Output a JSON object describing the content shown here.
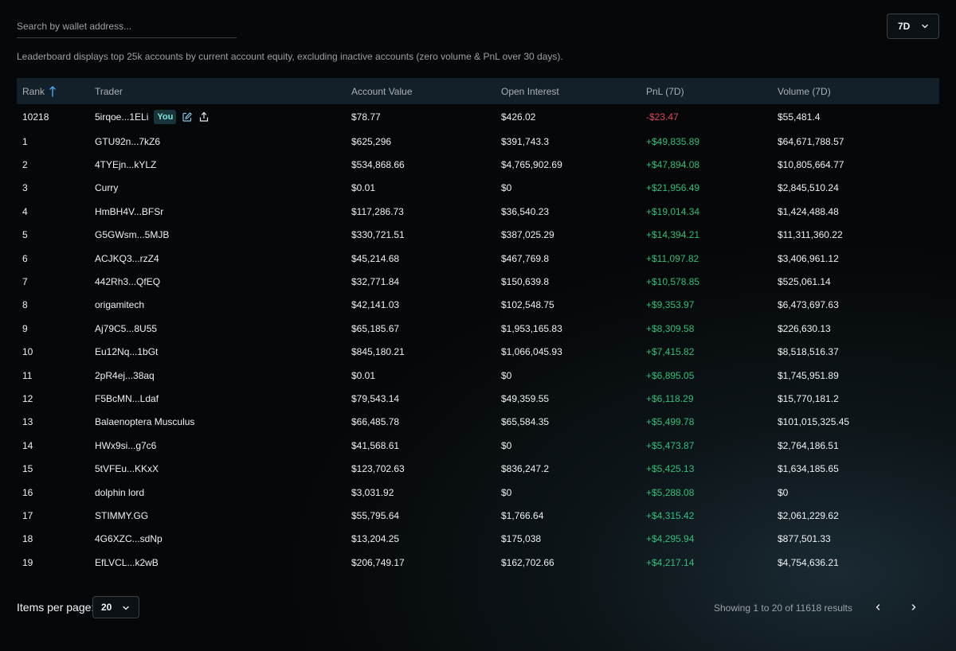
{
  "search": {
    "placeholder": "Search by wallet address..."
  },
  "period_select": {
    "value": "7D"
  },
  "info_text": "Leaderboard displays top 25k accounts by current account equity, excluding inactive accounts (zero volume & PnL over 30 days).",
  "columns": {
    "rank": "Rank",
    "trader": "Trader",
    "account_value": "Account Value",
    "open_interest": "Open Interest",
    "pnl": "PnL (7D)",
    "volume": "Volume (7D)"
  },
  "my_row": {
    "rank": "10218",
    "trader": "5irqoe...1ELi",
    "badge": "You",
    "account_value": "$78.77",
    "open_interest": "$426.02",
    "pnl": "-$23.47",
    "volume": "$55,481.4"
  },
  "rows": [
    {
      "rank": "1",
      "trader": "GTU92n...7kZ6",
      "account_value": "$625,296",
      "open_interest": "$391,743.3",
      "pnl": "+$49,835.89",
      "volume": "$64,671,788.57"
    },
    {
      "rank": "2",
      "trader": "4TYEjn...kYLZ",
      "account_value": "$534,868.66",
      "open_interest": "$4,765,902.69",
      "pnl": "+$47,894.08",
      "volume": "$10,805,664.77"
    },
    {
      "rank": "3",
      "trader": "Curry",
      "account_value": "$0.01",
      "open_interest": "$0",
      "pnl": "+$21,956.49",
      "volume": "$2,845,510.24"
    },
    {
      "rank": "4",
      "trader": "HmBH4V...BFSr",
      "account_value": "$117,286.73",
      "open_interest": "$36,540.23",
      "pnl": "+$19,014.34",
      "volume": "$1,424,488.48"
    },
    {
      "rank": "5",
      "trader": "G5GWsm...5MJB",
      "account_value": "$330,721.51",
      "open_interest": "$387,025.29",
      "pnl": "+$14,394.21",
      "volume": "$11,311,360.22"
    },
    {
      "rank": "6",
      "trader": "ACJKQ3...rzZ4",
      "account_value": "$45,214.68",
      "open_interest": "$467,769.8",
      "pnl": "+$11,097.82",
      "volume": "$3,406,961.12"
    },
    {
      "rank": "7",
      "trader": "442Rh3...QfEQ",
      "account_value": "$32,771.84",
      "open_interest": "$150,639.8",
      "pnl": "+$10,578.85",
      "volume": "$525,061.14"
    },
    {
      "rank": "8",
      "trader": "origamitech",
      "account_value": "$42,141.03",
      "open_interest": "$102,548.75",
      "pnl": "+$9,353.97",
      "volume": "$6,473,697.63"
    },
    {
      "rank": "9",
      "trader": "Aj79C5...8U55",
      "account_value": "$65,185.67",
      "open_interest": "$1,953,165.83",
      "pnl": "+$8,309.58",
      "volume": "$226,630.13"
    },
    {
      "rank": "10",
      "trader": "Eu12Nq...1bGt",
      "account_value": "$845,180.21",
      "open_interest": "$1,066,045.93",
      "pnl": "+$7,415.82",
      "volume": "$8,518,516.37"
    },
    {
      "rank": "11",
      "trader": "2pR4ej...38aq",
      "account_value": "$0.01",
      "open_interest": "$0",
      "pnl": "+$6,895.05",
      "volume": "$1,745,951.89"
    },
    {
      "rank": "12",
      "trader": "F5BcMN...Ldaf",
      "account_value": "$79,543.14",
      "open_interest": "$49,359.55",
      "pnl": "+$6,118.29",
      "volume": "$15,770,181.2"
    },
    {
      "rank": "13",
      "trader": "Balaenoptera Musculus",
      "account_value": "$66,485.78",
      "open_interest": "$65,584.35",
      "pnl": "+$5,499.78",
      "volume": "$101,015,325.45"
    },
    {
      "rank": "14",
      "trader": "HWx9si...g7c6",
      "account_value": "$41,568.61",
      "open_interest": "$0",
      "pnl": "+$5,473.87",
      "volume": "$2,764,186.51"
    },
    {
      "rank": "15",
      "trader": "5tVFEu...KKxX",
      "account_value": "$123,702.63",
      "open_interest": "$836,247.2",
      "pnl": "+$5,425.13",
      "volume": "$1,634,185.65"
    },
    {
      "rank": "16",
      "trader": "dolphin lord",
      "account_value": "$3,031.92",
      "open_interest": "$0",
      "pnl": "+$5,288.08",
      "volume": "$0"
    },
    {
      "rank": "17",
      "trader": "STIMMY.GG",
      "account_value": "$55,795.64",
      "open_interest": "$1,766.64",
      "pnl": "+$4,315.42",
      "volume": "$2,061,229.62"
    },
    {
      "rank": "18",
      "trader": "4G6XZC...sdNp",
      "account_value": "$13,204.25",
      "open_interest": "$175,038",
      "pnl": "+$4,295.94",
      "volume": "$877,501.33"
    },
    {
      "rank": "19",
      "trader": "EfLVCL...k2wB",
      "account_value": "$206,749.17",
      "open_interest": "$162,702.66",
      "pnl": "+$4,217.14",
      "volume": "$4,754,636.21"
    }
  ],
  "footer": {
    "items_per_page_label": "Items per page:",
    "items_per_page_value": "20",
    "results_text": "Showing 1 to 20 of 11618 results"
  },
  "colors": {
    "positive": "#2fbf7a",
    "negative": "#e0445e",
    "header_bg": "#142029",
    "accent": "#4aa8e8"
  }
}
